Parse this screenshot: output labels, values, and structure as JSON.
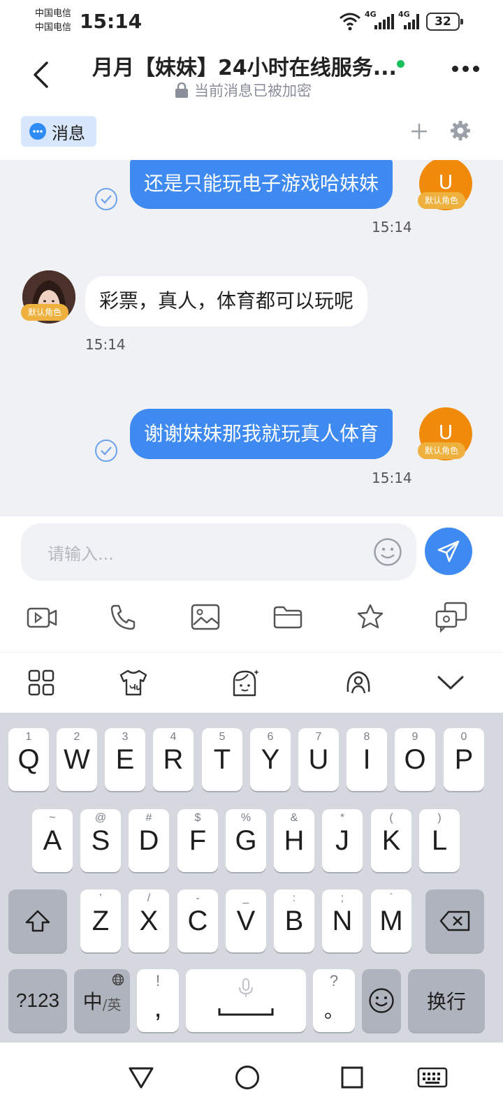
{
  "status_bar": {
    "carrier_1": "中国电信",
    "carrier_2": "中国电信",
    "time": "15:14",
    "network_1": "4G",
    "network_2": "4G",
    "battery": "32"
  },
  "header": {
    "title": "月月【妹妹】24小时在线服务...",
    "subtitle": "当前消息已被加密",
    "online_color": "#19c15b"
  },
  "tabs": {
    "messages_label": "消息"
  },
  "chat": {
    "messages": [
      {
        "direction": "out",
        "text": "还是只能玩电子游戏哈妹妹",
        "time": "15:14",
        "avatar_letter": "U",
        "role": "默认角色"
      },
      {
        "direction": "in",
        "text": "彩票，真人，体育都可以玩呢",
        "time": "15:14",
        "role": "默认角色"
      },
      {
        "direction": "out",
        "text": "谢谢妹妹那我就玩真人体育",
        "time": "15:14",
        "avatar_letter": "U",
        "role": "默认角色"
      }
    ]
  },
  "composer": {
    "placeholder": "请输入..."
  },
  "keyboard": {
    "row1": [
      {
        "key": "Q",
        "sub": "1"
      },
      {
        "key": "W",
        "sub": "2"
      },
      {
        "key": "E",
        "sub": "3"
      },
      {
        "key": "R",
        "sub": "4"
      },
      {
        "key": "T",
        "sub": "5"
      },
      {
        "key": "Y",
        "sub": "6"
      },
      {
        "key": "U",
        "sub": "7"
      },
      {
        "key": "I",
        "sub": "8"
      },
      {
        "key": "O",
        "sub": "9"
      },
      {
        "key": "P",
        "sub": "0"
      }
    ],
    "row2": [
      {
        "key": "A",
        "sub": "~"
      },
      {
        "key": "S",
        "sub": "@"
      },
      {
        "key": "D",
        "sub": "#"
      },
      {
        "key": "F",
        "sub": "$"
      },
      {
        "key": "G",
        "sub": "%"
      },
      {
        "key": "H",
        "sub": "&"
      },
      {
        "key": "J",
        "sub": "*"
      },
      {
        "key": "K",
        "sub": "("
      },
      {
        "key": "L",
        "sub": ")"
      }
    ],
    "row3": [
      {
        "key": "Z",
        "sub": "'"
      },
      {
        "key": "X",
        "sub": "/"
      },
      {
        "key": "C",
        "sub": "-"
      },
      {
        "key": "V",
        "sub": "_"
      },
      {
        "key": "B",
        "sub": ":"
      },
      {
        "key": "N",
        "sub": ";"
      },
      {
        "key": "M",
        "sub": "`"
      }
    ],
    "symbols_label": "?123",
    "lang_main": "中",
    "lang_alt": "/英",
    "comma_key": ",",
    "comma_sub": "!",
    "period_key": "。",
    "period_sub": "?",
    "enter_label": "换行"
  },
  "colors": {
    "accent": "#3e8af0",
    "avatar": "#f08a0b",
    "role_tag": "#efb13e",
    "chat_bg": "#f0f1f5"
  }
}
